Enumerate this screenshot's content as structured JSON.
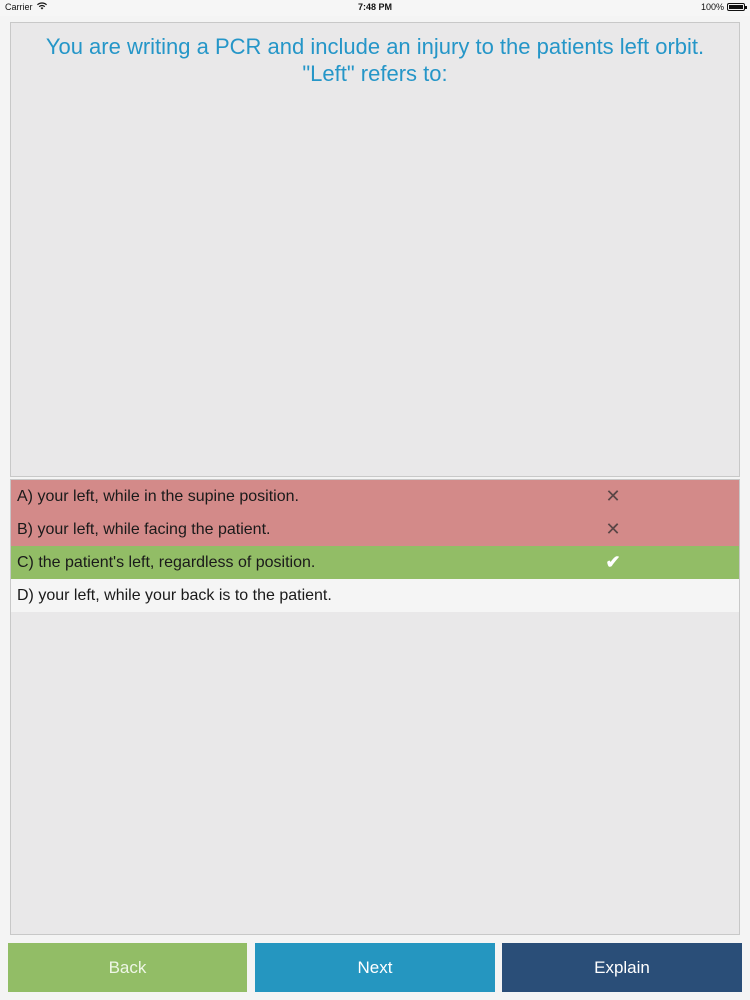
{
  "status_bar": {
    "carrier": "Carrier",
    "time": "7:48 PM",
    "battery": "100%"
  },
  "question": {
    "line1": "You are writing a PCR and include an injury to the patients left orbit.",
    "line2": "\"Left\" refers to:"
  },
  "answers": [
    {
      "label": "A) your left, while in the supine position.",
      "mark": "✕",
      "state": "wrong"
    },
    {
      "label": "B) your left, while facing the patient.",
      "mark": "✕",
      "state": "wrong"
    },
    {
      "label": "C) the patient's left, regardless of position.",
      "mark": "✔",
      "state": "correct"
    },
    {
      "label": "D) your left, while your back is to the patient.",
      "mark": "",
      "state": "unanswered"
    }
  ],
  "buttons": {
    "back": "Back",
    "next": "Next",
    "explain": "Explain"
  },
  "colors": {
    "question_text": "#2596c8",
    "wrong": "#d38a89",
    "correct": "#92bd66",
    "back_button": "#92bd66",
    "next_button": "#2596c0",
    "explain_button": "#2a4e78"
  }
}
